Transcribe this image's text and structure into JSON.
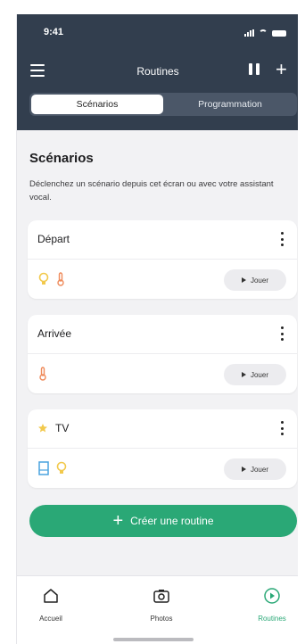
{
  "status": {
    "time": "9:41"
  },
  "header": {
    "title": "Routines",
    "tabs": [
      {
        "label": "Scénarios",
        "active": true
      },
      {
        "label": "Programmation",
        "active": false
      }
    ]
  },
  "section": {
    "title": "Scénarios",
    "description": "Déclenchez un scénario depuis cet écran ou avec votre assistant vocal."
  },
  "scenarios": [
    {
      "name": "Départ",
      "icons": [
        "bulb-icon",
        "thermometer-icon"
      ],
      "play_label": "Jouer"
    },
    {
      "name": "Arrivée",
      "icons": [
        "thermometer-icon"
      ],
      "play_label": "Jouer"
    },
    {
      "name": "TV",
      "favorite": true,
      "icons": [
        "shutter-icon",
        "bulb-icon"
      ],
      "play_label": "Jouer"
    }
  ],
  "create_button": {
    "label": "Créer une routine"
  },
  "bottom_nav": [
    {
      "label": "Accueil",
      "icon": "home-icon",
      "active": false
    },
    {
      "label": "Photos",
      "icon": "camera-icon",
      "active": false
    },
    {
      "label": "Routines",
      "icon": "routines-play-icon",
      "active": true
    }
  ],
  "colors": {
    "header_bg": "#323e4e",
    "accent_green": "#2aa876",
    "bulb": "#f2c94c",
    "thermometer": "#ef8a5a",
    "star": "#f2c94c",
    "shutter": "#4aa3df"
  }
}
